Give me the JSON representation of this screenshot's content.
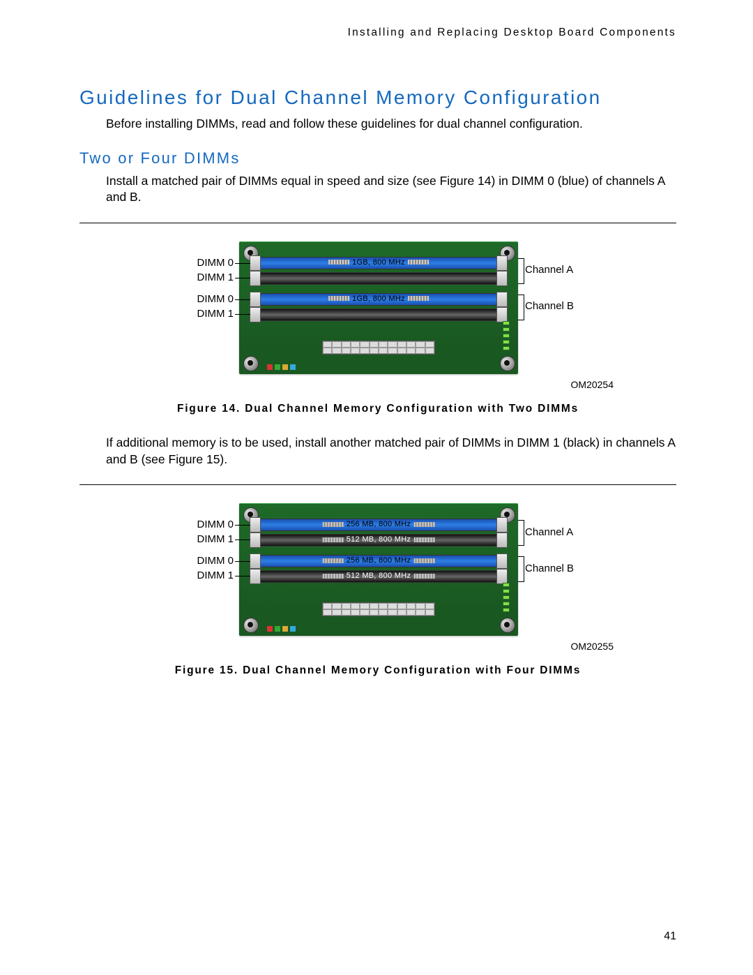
{
  "header": "Installing and Replacing Desktop Board Components",
  "title": "Guidelines for Dual Channel Memory Configuration",
  "intro": "Before installing DIMMs, read and follow these guidelines for dual channel configuration.",
  "subsection": "Two or Four DIMMs",
  "para1": "Install a matched pair of DIMMs equal in speed and size (see Figure 14) in DIMM 0 (blue) of channels A and B.",
  "para2": "If additional memory is to be used, install another matched pair of DIMMs in DIMM 1 (black) in channels A and B (see Figure 15).",
  "figures": {
    "f14": {
      "caption": "Figure 14.  Dual Channel Memory Configuration with Two DIMMs",
      "om": "OM20254",
      "left_labels": [
        "DIMM 0",
        "DIMM 1",
        "DIMM 0",
        "DIMM 1"
      ],
      "right_labels": [
        "Channel A",
        "Channel B"
      ],
      "slots": [
        {
          "color": "blue",
          "text": "1GB, 800 MHz",
          "hatch": true
        },
        {
          "color": "black",
          "text": "",
          "hatch": false
        },
        {
          "color": "blue",
          "text": "1GB, 800 MHz",
          "hatch": true
        },
        {
          "color": "black",
          "text": "",
          "hatch": false
        }
      ]
    },
    "f15": {
      "caption": "Figure 15.  Dual Channel Memory Configuration with Four DIMMs",
      "om": "OM20255",
      "left_labels": [
        "DIMM 0",
        "DIMM 1",
        "DIMM 0",
        "DIMM 1"
      ],
      "right_labels": [
        "Channel A",
        "Channel B"
      ],
      "slots": [
        {
          "color": "blue",
          "text": "256 MB, 800 MHz",
          "hatch": true
        },
        {
          "color": "black",
          "text": "512 MB, 800 MHz",
          "hatch": true
        },
        {
          "color": "blue",
          "text": "256 MB, 800 MHz",
          "hatch": true
        },
        {
          "color": "black",
          "text": "512 MB, 800 MHz",
          "hatch": true
        }
      ]
    }
  },
  "page_number": "41"
}
